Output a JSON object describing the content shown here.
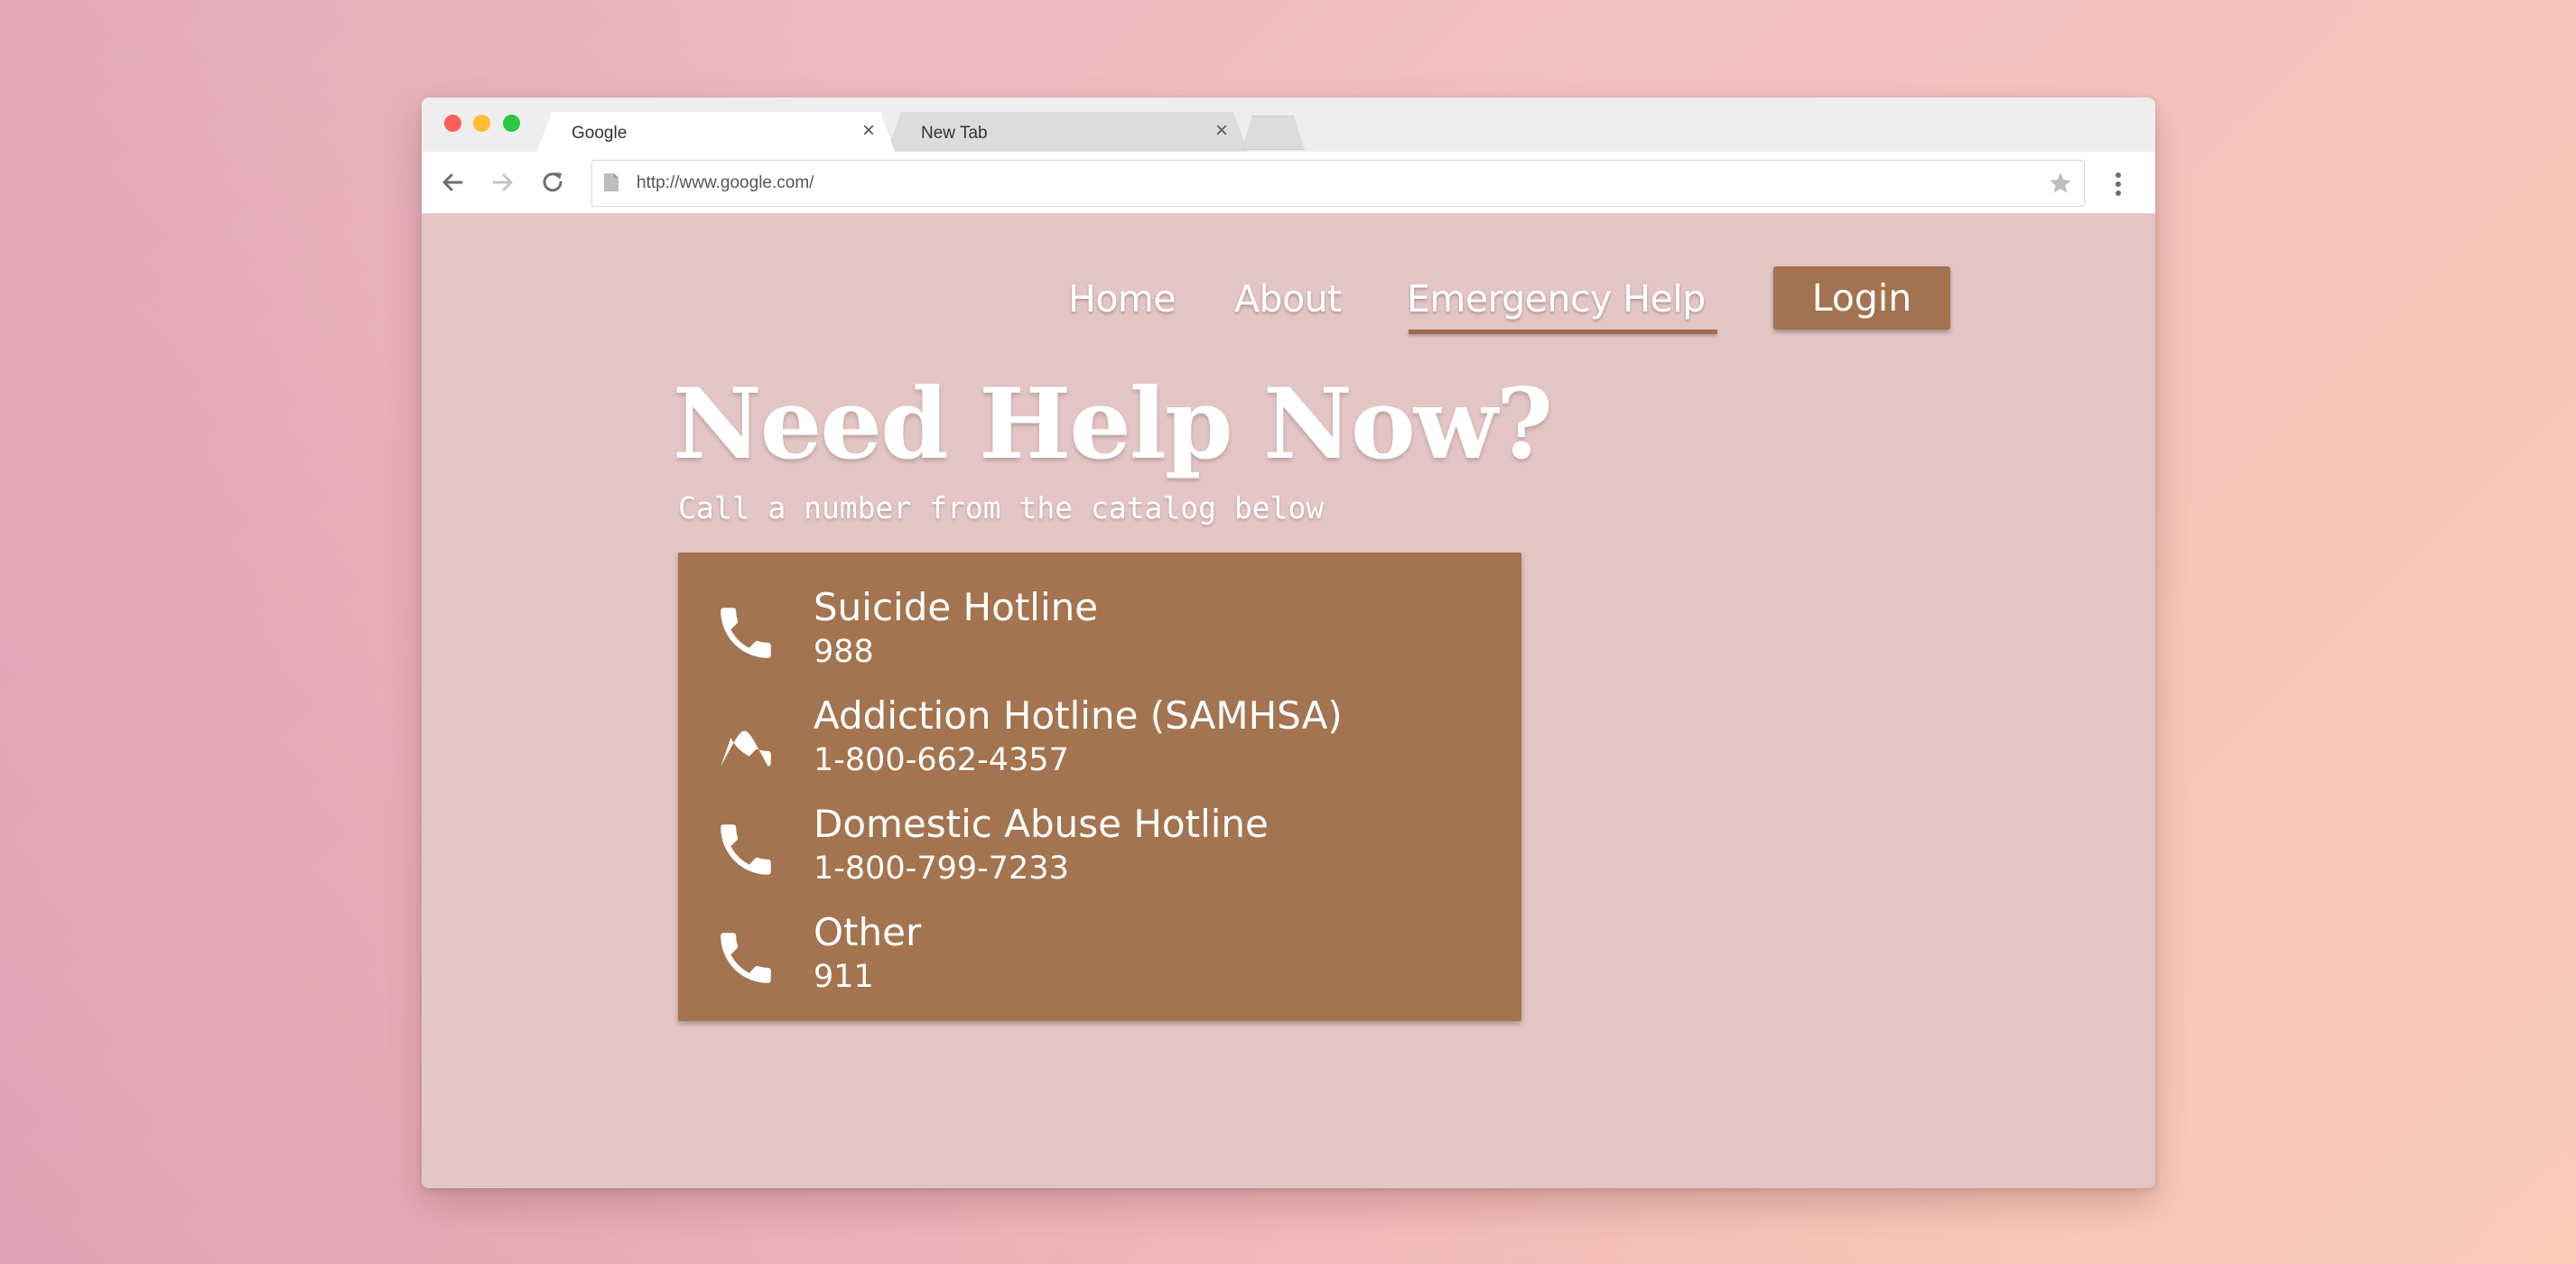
{
  "browser": {
    "tabs": [
      {
        "title": "Google",
        "active": true
      },
      {
        "title": "New Tab",
        "active": false
      }
    ],
    "url": "http://www.google.com/"
  },
  "nav": {
    "items": [
      {
        "label": "Home"
      },
      {
        "label": "About"
      },
      {
        "label": "Emergency Help",
        "active": true
      }
    ],
    "login_label": "Login"
  },
  "hero": {
    "title": "Need Help Now?",
    "subtitle": "Call a number from the catalog below"
  },
  "hotlines": [
    {
      "name": "Suicide Hotline",
      "number": "988",
      "icon": "phone-icon"
    },
    {
      "name": "Addiction Hotline (SAMHSA)",
      "number": "1-800-662-4357",
      "icon": "phone-icon"
    },
    {
      "name": "Domestic Abuse Hotline",
      "number": "1-800-799-7233",
      "icon": "phone-icon"
    },
    {
      "name": "Other",
      "number": "911",
      "icon": "phone-icon"
    }
  ],
  "colors": {
    "page_background": "#e4c5c5",
    "accent": "#a3744f",
    "text": "#ffffff"
  }
}
